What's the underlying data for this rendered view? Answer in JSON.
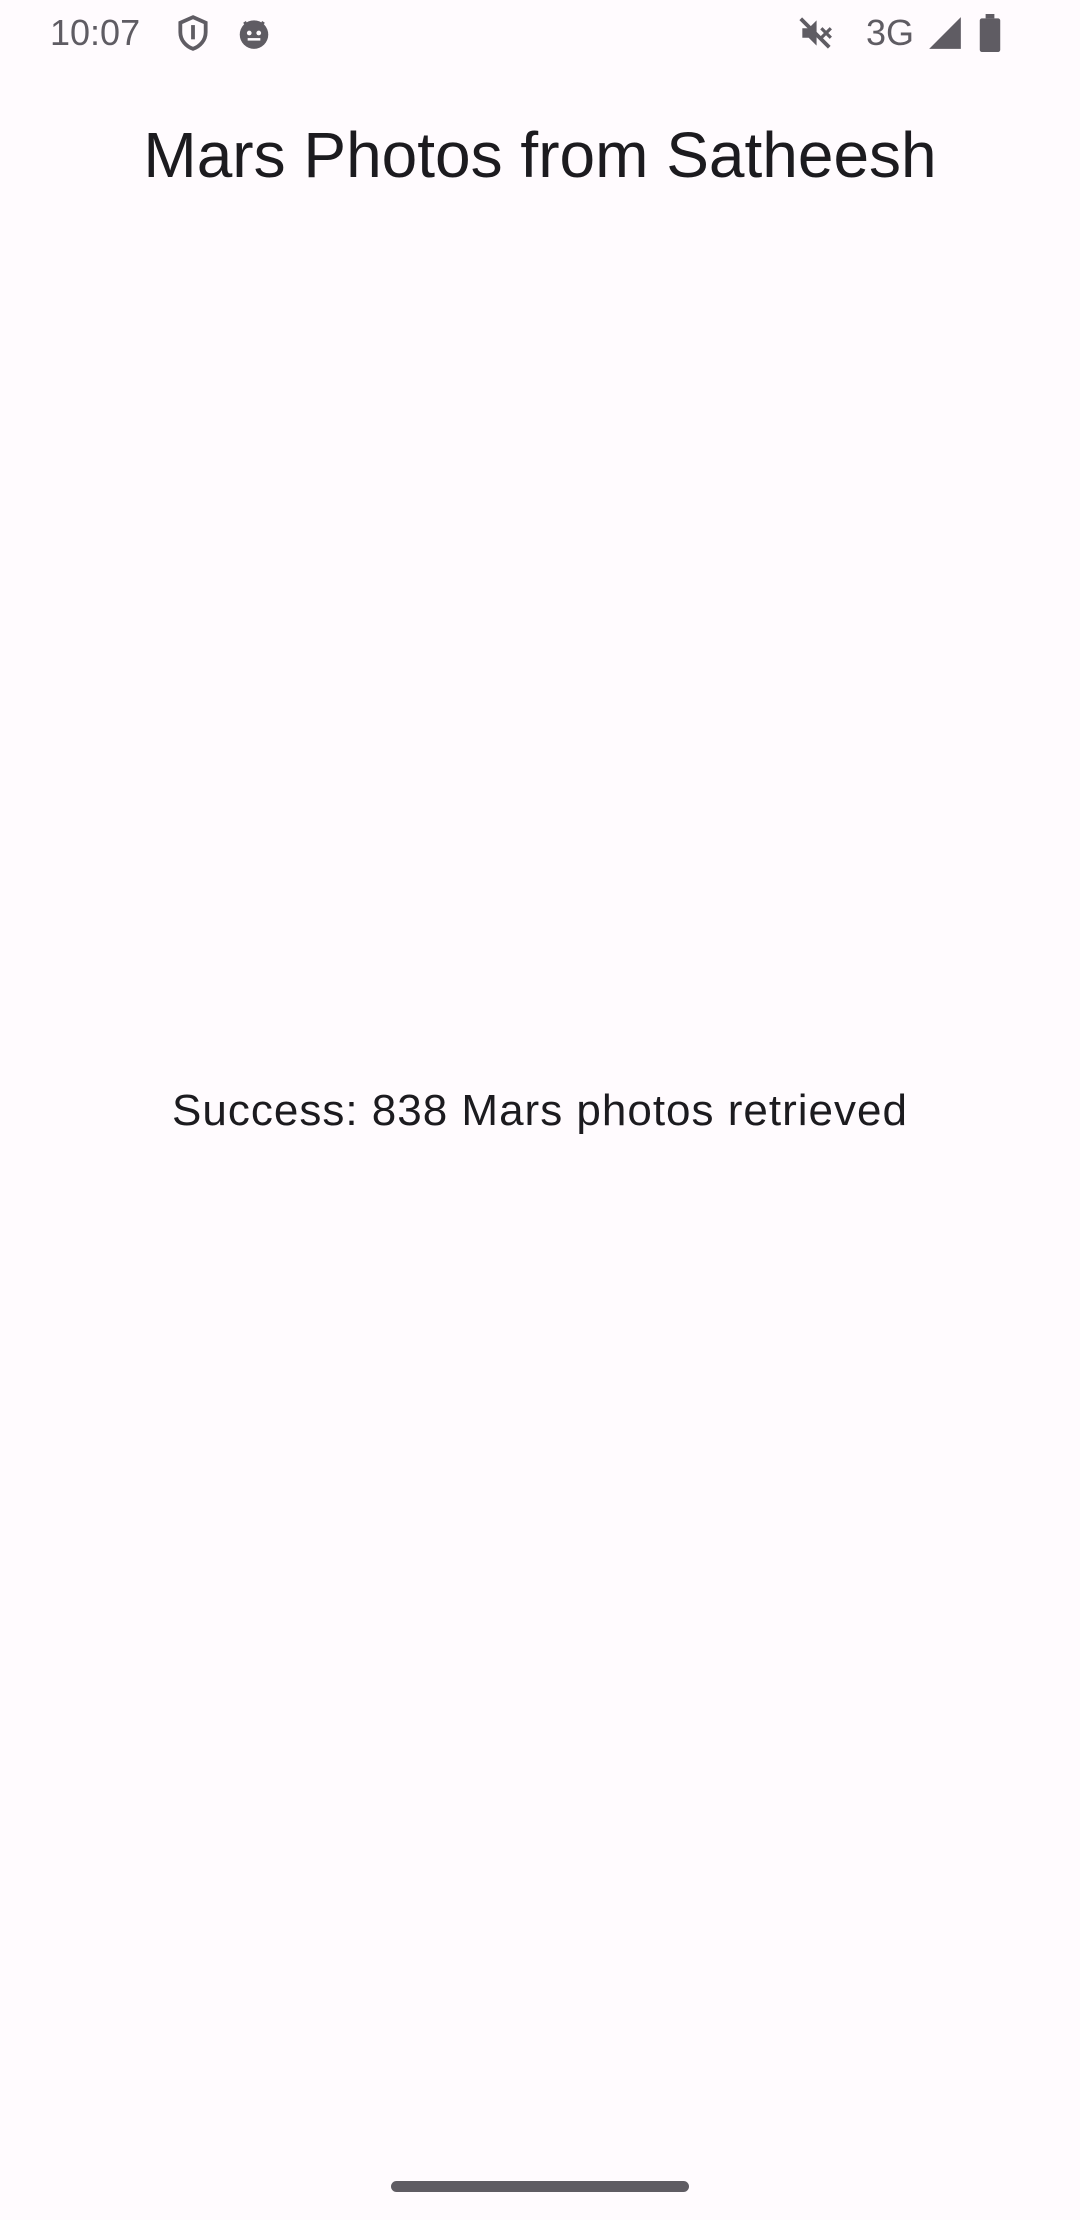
{
  "status_bar": {
    "time": "10:07",
    "network_type": "3G",
    "icons": [
      "shield-icon",
      "android-face-icon",
      "mute-icon",
      "signal-icon",
      "battery-icon"
    ],
    "icon_color": "#5f5c63"
  },
  "app": {
    "title": "Mars Photos from Satheesh",
    "background_color": "#fffbfe"
  },
  "content": {
    "result_message": "Success: 838 Mars photos retrieved"
  }
}
